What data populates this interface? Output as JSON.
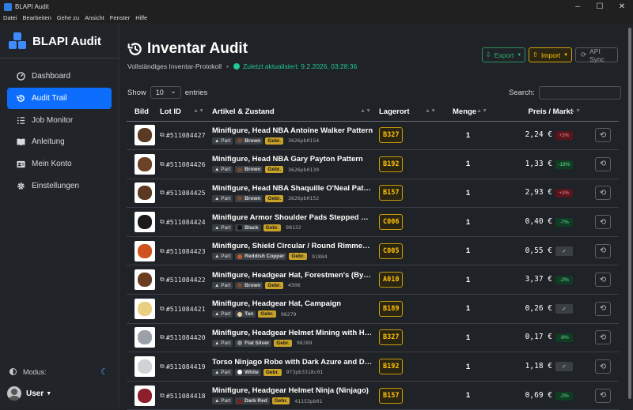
{
  "window": {
    "title": "BLAPI Audit"
  },
  "menu": [
    "Datei",
    "Bearbeiten",
    "Gehe zu",
    "Ansicht",
    "Fenster",
    "Hilfe"
  ],
  "sidebar": {
    "brand": "BLAPI Audit",
    "items": [
      {
        "label": "Dashboard",
        "icon": "gauge-icon"
      },
      {
        "label": "Audit Trail",
        "icon": "history-icon",
        "active": true
      },
      {
        "label": "Job Monitor",
        "icon": "list-check-icon"
      },
      {
        "label": "Anleitung",
        "icon": "book-icon"
      },
      {
        "label": "Mein Konto",
        "icon": "id-card-icon"
      },
      {
        "label": "Einstellungen",
        "icon": "gear-icon"
      }
    ],
    "mode_label": "Modus:",
    "user_label": "User"
  },
  "page": {
    "title": "Inventar Audit",
    "subtitle": "Vollständiges Inventar-Protokoll",
    "updated": "Zuletzt aktualisiert: 9.2.2026, 03:28:36",
    "export_label": "Export",
    "import_label": "Import",
    "sync_label": "API Sync",
    "show_label": "Show",
    "entries_value": "10",
    "entries_label": "entries",
    "search_label": "Search:"
  },
  "table": {
    "headers": [
      "Bild",
      "Lot ID",
      "Artikel & Zustand",
      "Lagerort",
      "Menge",
      "Preis / Markt"
    ],
    "rows": [
      {
        "lot": "#511084427",
        "name": "Minifigure, Head NBA Antoine Walker Pattern",
        "type": "Part",
        "color": "Brown",
        "color_hex": "#7a4a2a",
        "cond": "Gebr.",
        "code": "3626pb0154",
        "loc": "B327",
        "qty": "1",
        "price": "2,24 €",
        "chg": "+3%",
        "chg_type": "up",
        "img": "#5a3a22"
      },
      {
        "lot": "#511084426",
        "name": "Minifigure, Head NBA Gary Payton Pattern",
        "type": "Part",
        "color": "Brown",
        "color_hex": "#7a4a2a",
        "cond": "Gebr.",
        "code": "3626pb0139",
        "loc": "B192",
        "qty": "1",
        "price": "1,33 €",
        "chg": "-19%",
        "chg_type": "down",
        "img": "#6b4226"
      },
      {
        "lot": "#511084425",
        "name": "Minifigure, Head NBA Shaquille O'Neal Pattern",
        "type": "Part",
        "color": "Brown",
        "color_hex": "#7a4a2a",
        "cond": "Gebr.",
        "code": "3626pb0152",
        "loc": "B157",
        "qty": "1",
        "price": "2,93 €",
        "chg": "+3%",
        "chg_type": "up",
        "img": "#5b3a21"
      },
      {
        "lot": "#511084424",
        "name": "Minifigure Armor Shoulder Pads Stepped with Sword Holder",
        "type": "Part",
        "color": "Black",
        "color_hex": "#111111",
        "cond": "Gebr.",
        "code": "98132",
        "loc": "C006",
        "qty": "1",
        "price": "0,40 €",
        "chg": "-7%",
        "chg_type": "down",
        "img": "#1a1a1a"
      },
      {
        "lot": "#511084423",
        "name": "Minifigure, Shield Circular / Round Rimmed with Stud",
        "type": "Part",
        "color": "Reddish Copper",
        "color_hex": "#c25a2a",
        "cond": "Gebr.",
        "code": "91884",
        "loc": "C005",
        "qty": "1",
        "price": "0,55 €",
        "chg": "✓",
        "chg_type": "ok",
        "img": "#d0531f"
      },
      {
        "lot": "#511084422",
        "name": "Minifigure, Headgear Hat, Forestmen's (Bycocket)",
        "type": "Part",
        "color": "Brown",
        "color_hex": "#7a4a2a",
        "cond": "Gebr.",
        "code": "4506",
        "loc": "A010",
        "qty": "1",
        "price": "3,37 €",
        "chg": "-2%",
        "chg_type": "down",
        "img": "#6b3e22"
      },
      {
        "lot": "#511084421",
        "name": "Minifigure, Headgear Hat, Campaign",
        "type": "Part",
        "color": "Tan",
        "color_hex": "#e4cd9e",
        "cond": "Gebr.",
        "code": "98279",
        "loc": "B189",
        "qty": "1",
        "price": "0,26 €",
        "chg": "✓",
        "chg_type": "ok",
        "img": "#e9cf82"
      },
      {
        "lot": "#511084420",
        "name": "Minifigure, Headgear Helmet Mining with Headlamp",
        "type": "Part",
        "color": "Flat Silver",
        "color_hex": "#8a9299",
        "cond": "Gebr.",
        "code": "98289",
        "loc": "B327",
        "qty": "1",
        "price": "0,17 €",
        "chg": "-8%",
        "chg_type": "down",
        "img": "#9aa1a8"
      },
      {
        "lot": "#511084419",
        "name": "Torso Ninjago Robe with Dark Azure and Dark Blue",
        "type": "Part",
        "color": "White",
        "color_hex": "#ffffff",
        "cond": "Gebr.",
        "code": "973pb3318c01",
        "loc": "B192",
        "qty": "1",
        "price": "1,18 €",
        "chg": "✓",
        "chg_type": "ok",
        "img": "#cfd3d6"
      },
      {
        "lot": "#511084418",
        "name": "Minifigure, Headgear Helmet Ninja (Ninjago)",
        "type": "Part",
        "color": "Dark Red",
        "color_hex": "#7b1e1e",
        "cond": "Gebr.",
        "code": "41153pb01",
        "loc": "B157",
        "qty": "1",
        "price": "0,69 €",
        "chg": "-2%",
        "chg_type": "down",
        "img": "#8c1f2a"
      }
    ]
  }
}
